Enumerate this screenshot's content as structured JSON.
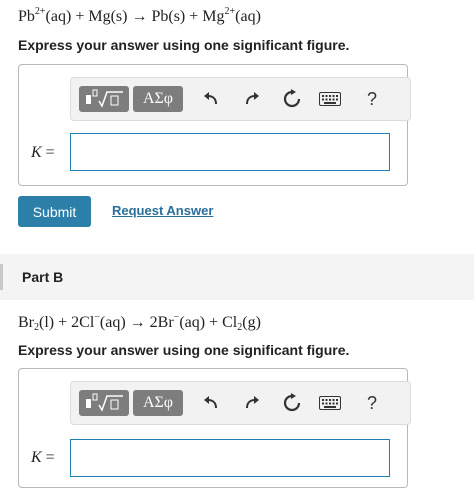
{
  "partA": {
    "equation": {
      "s1": "Pb",
      "s1_sup": "2+",
      "s1_phase": "(aq)",
      "plus1": "+",
      "s2": "Mg",
      "s2_phase": "(s)",
      "arrow": "→",
      "s3": "Pb",
      "s3_phase": "(s)",
      "plus2": "+",
      "s4": "Mg",
      "s4_sup": "2+",
      "s4_phase": "(aq)"
    },
    "instruction": "Express your answer using one significant figure.",
    "answer_label_var": "K",
    "answer_label_eq": "=",
    "answer_value": ""
  },
  "toolbar": {
    "greek_label": "ΑΣφ",
    "help_label": "?",
    "icons": [
      "templates-icon",
      "greek-symbols-icon",
      "undo-icon",
      "redo-icon",
      "reset-icon",
      "keyboard-icon",
      "help-icon"
    ]
  },
  "actions": {
    "submit_label": "Submit",
    "request_answer_label": "Request Answer"
  },
  "partB": {
    "title": "Part B",
    "equation": {
      "s1": "Br",
      "s1_sub": "2",
      "s1_phase": "(l)",
      "plus1": "+",
      "s2": "2Cl",
      "s2_sup": "−",
      "s2_phase": "(aq)",
      "arrow": "→",
      "s3": "2Br",
      "s3_sup": "−",
      "s3_phase": "(aq)",
      "plus2": "+",
      "s4": "Cl",
      "s4_sub": "2",
      "s4_phase": "(g)"
    },
    "instruction": "Express your answer using one significant figure.",
    "answer_label_var": "K",
    "answer_label_eq": "=",
    "answer_value": ""
  },
  "colors": {
    "submit": "#2b7fa8",
    "link": "#2a6f9c",
    "input_border": "#1f7fb6",
    "toolbar_button": "#7d7d7d"
  }
}
